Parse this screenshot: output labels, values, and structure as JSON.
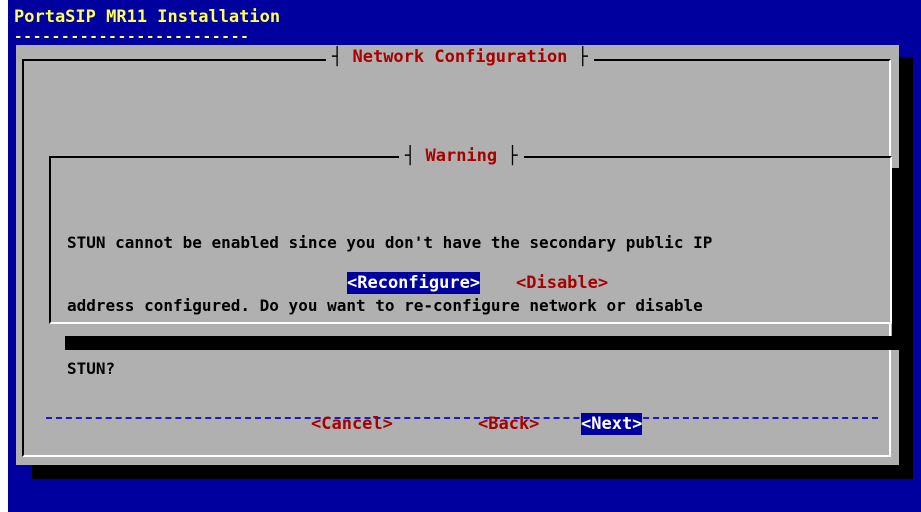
{
  "window": {
    "title": "PortaSIP MR11 Installation",
    "title_underline": "-------------------------"
  },
  "main": {
    "title": "Network Configuration",
    "buttons": {
      "cancel": "<Cancel>",
      "back": "<Back>",
      "next": "<Next>"
    }
  },
  "dialog": {
    "title": "Warning",
    "message_lines": [
      "STUN cannot be enabled since you don't have the secondary public IP",
      "address configured. Do you want to re-configure network or disable",
      "STUN?"
    ],
    "buttons": {
      "reconfigure": "<Reconfigure>",
      "disable": "<Disable>"
    }
  },
  "colors": {
    "background": "#00009e",
    "window": "#b0b0b0",
    "accent": "#a80000",
    "title": "#ffff55"
  }
}
